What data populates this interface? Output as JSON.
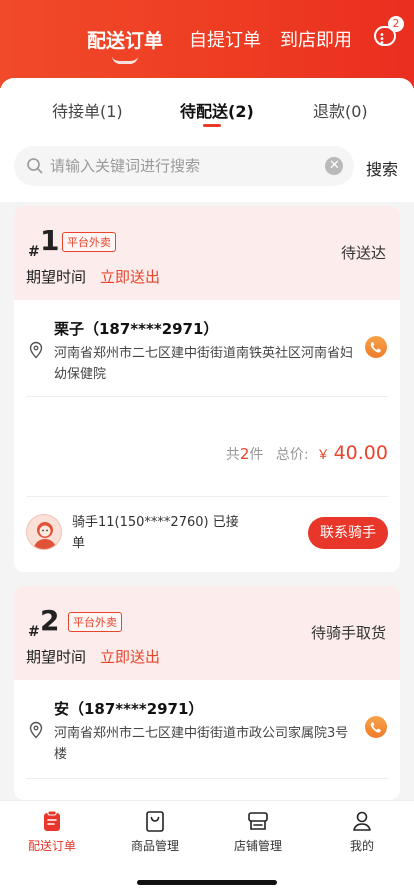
{
  "header": {
    "tabs": [
      "配送订单",
      "自提订单",
      "到店即用"
    ],
    "active_tab": 0,
    "message_badge": "2"
  },
  "status_tabs": [
    "待接单(1)",
    "待配送(2)",
    "退款(0)"
  ],
  "active_status_tab": 1,
  "search": {
    "placeholder": "请输入关键词进行搜索",
    "button_label": "搜索"
  },
  "orders": [
    {
      "hash": "#",
      "number": "1",
      "source": "平台外卖",
      "status": "待送达",
      "expected_label": "期望时间",
      "expected_value": "立即送出",
      "customer": "栗子（187****2971）",
      "address": "河南省郑州市二七区建中街街道南铁英社区河南省妇幼保健院",
      "count_prefix": "共",
      "count": "2",
      "count_suffix": "件",
      "total_label": "总价:",
      "currency": "￥",
      "total": "40.00",
      "rider": "骑手11(150****2760) 已接单",
      "contact_label": "联系骑手"
    },
    {
      "hash": "#",
      "number": "2",
      "source": "平台外卖",
      "status": "待骑手取货",
      "expected_label": "期望时间",
      "expected_value": "立即送出",
      "customer": "安（187****2971）",
      "address": "河南省郑州市二七区建中街街道市政公司家属院3号楼"
    }
  ],
  "tabbar": [
    {
      "label": "配送订单",
      "icon": "clipboard-icon",
      "active": true
    },
    {
      "label": "商品管理",
      "icon": "shopping-bag-icon",
      "active": false
    },
    {
      "label": "店铺管理",
      "icon": "store-icon",
      "active": false
    },
    {
      "label": "我的",
      "icon": "user-icon",
      "active": false
    }
  ],
  "colors": {
    "brand": "#ee3b22",
    "accent_text": "#e8452c",
    "card_header_bg": "#fcecec"
  }
}
